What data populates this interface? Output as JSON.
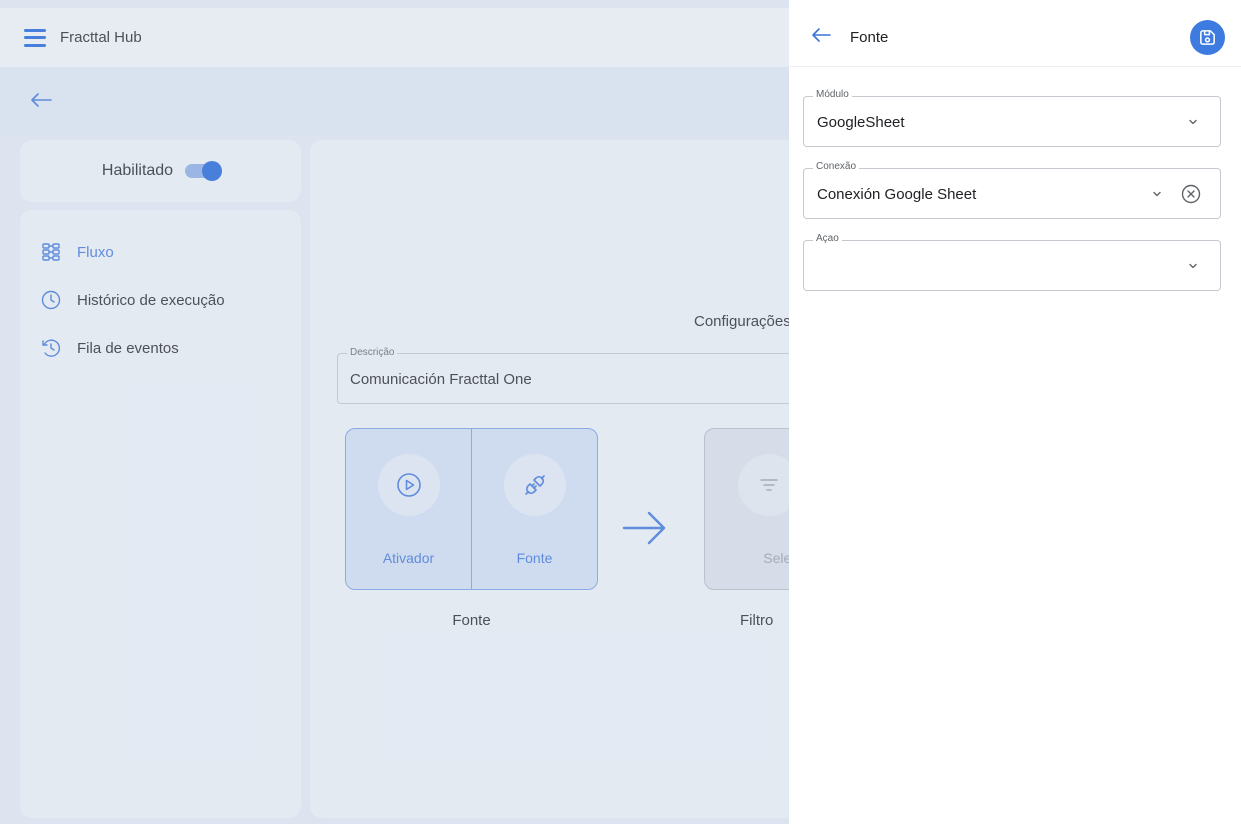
{
  "app": {
    "title": "Fracttal Hub"
  },
  "status": {
    "label": "Habilitado",
    "enabled": true
  },
  "nav": {
    "items": [
      {
        "label": "Fluxo",
        "icon": "flow-icon",
        "active": true
      },
      {
        "label": "Histórico de execução",
        "icon": "clock-icon",
        "active": false
      },
      {
        "label": "Fila de eventos",
        "icon": "history-icon",
        "active": false
      }
    ]
  },
  "main": {
    "config_title": "Configurações",
    "description": {
      "label": "Descrição",
      "value": "Comunicación Fracttal One"
    },
    "source_group": {
      "steps": [
        {
          "label": "Ativador",
          "icon": "play-circle-icon"
        },
        {
          "label": "Fonte",
          "icon": "plug-icon"
        }
      ],
      "caption": "Fonte"
    },
    "filter_step": {
      "label": "Selecione",
      "icon": "filter-icon",
      "caption": "Filtro"
    }
  },
  "panel": {
    "title": "Fonte",
    "save_icon": "save-icon",
    "fields": {
      "modulo": {
        "label": "Módulo",
        "value": "GoogleSheet"
      },
      "conexao": {
        "label": "Conexão",
        "value": "Conexión Google Sheet"
      },
      "acao": {
        "label": "Açao",
        "value": ""
      }
    }
  },
  "colors": {
    "primary": "#1b62d8",
    "accent": "#3d7be0",
    "active_text": "#3b73d9"
  }
}
